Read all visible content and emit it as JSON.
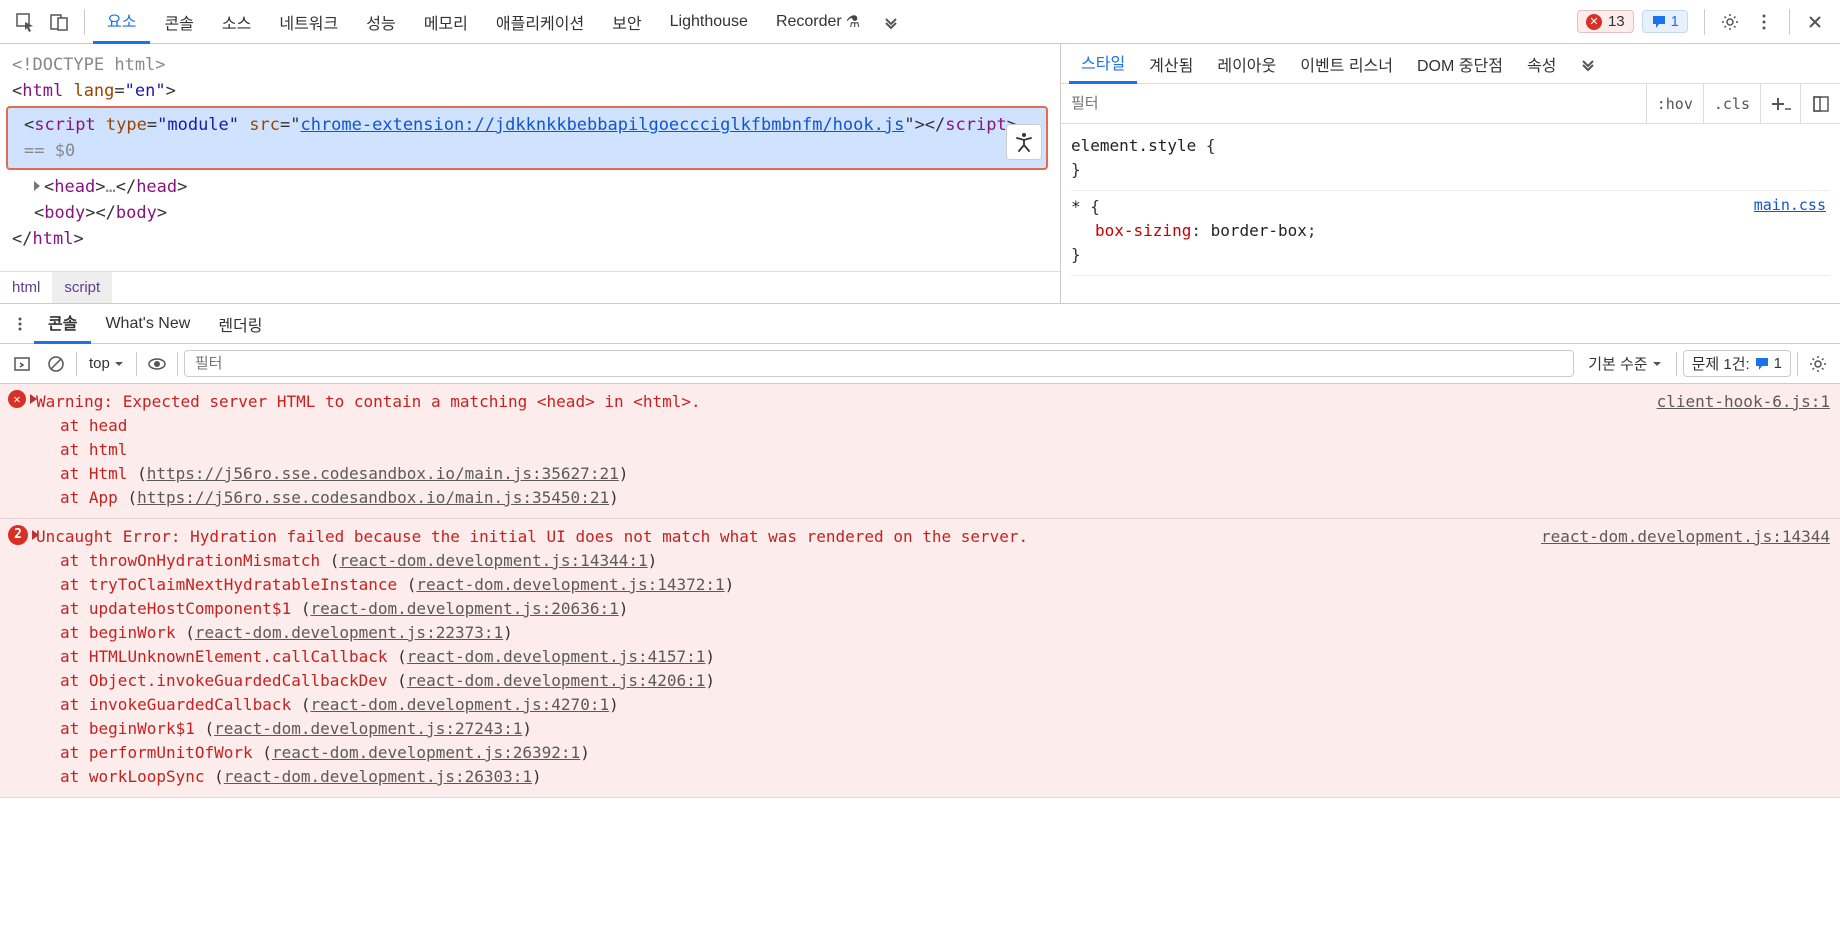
{
  "toolbar": {
    "tabs": [
      "요소",
      "콘솔",
      "소스",
      "네트워크",
      "성능",
      "메모리",
      "애플리케이션",
      "보안",
      "Lighthouse",
      "Recorder"
    ],
    "active_tab": 0,
    "error_count": "13",
    "message_count": "1"
  },
  "dom": {
    "doctype": "<!DOCTYPE html>",
    "html_open": "html",
    "html_lang_attr": "lang",
    "html_lang_val": "\"en\"",
    "script_tag": "script",
    "script_type_attr": "type",
    "script_type_val": "\"module\"",
    "script_src_attr": "src",
    "script_src_val": "chrome-extension://jdkknkkbebbapilgoeccciglkfbmbnfm/hook.js",
    "eq0": "== $0",
    "head": "head",
    "head_ellipsis": "…",
    "body": "body",
    "html_close": "html"
  },
  "breadcrumb": {
    "items": [
      "html",
      "script"
    ]
  },
  "styles_panel": {
    "tabs": [
      "스타일",
      "계산됨",
      "레이아웃",
      "이벤트 리스너",
      "DOM 중단점",
      "속성"
    ],
    "filter_placeholder": "필터",
    "hov": ":hov",
    "cls": ".cls",
    "rule1_selector": "element.style",
    "rule2_selector": "*",
    "rule2_src": "main.css",
    "rule2_prop": "box-sizing",
    "rule2_val": "border-box"
  },
  "drawer": {
    "tabs": [
      "콘솔",
      "What's New",
      "렌더링"
    ],
    "active": 0
  },
  "console_toolbar": {
    "context": "top",
    "filter_placeholder": "필터",
    "level_label": "기본 수준",
    "issues_label": "문제 1건:",
    "issues_count": "1"
  },
  "console": {
    "msg1": {
      "text": "Warning: Expected server HTML to contain a matching <head> in <html>.",
      "src": "client-hook-6.js:1",
      "stack": [
        {
          "at": "at ",
          "fn": "head",
          "loc": ""
        },
        {
          "at": "at ",
          "fn": "html",
          "loc": ""
        },
        {
          "at": "at ",
          "fn": "Html",
          "loc": "https://j56ro.sse.codesandbox.io/main.js:35627:21"
        },
        {
          "at": "at ",
          "fn": "App",
          "loc": "https://j56ro.sse.codesandbox.io/main.js:35450:21"
        }
      ]
    },
    "msg2": {
      "count": "2",
      "text": "Uncaught Error: Hydration failed because the initial UI does not match what was rendered on the server.",
      "src": "react-dom.development.js:14344",
      "stack": [
        {
          "at": "at ",
          "fn": "throwOnHydrationMismatch",
          "loc": "react-dom.development.js:14344:1"
        },
        {
          "at": "at ",
          "fn": "tryToClaimNextHydratableInstance",
          "loc": "react-dom.development.js:14372:1"
        },
        {
          "at": "at ",
          "fn": "updateHostComponent$1",
          "loc": "react-dom.development.js:20636:1"
        },
        {
          "at": "at ",
          "fn": "beginWork",
          "loc": "react-dom.development.js:22373:1"
        },
        {
          "at": "at ",
          "fn": "HTMLUnknownElement.callCallback",
          "loc": "react-dom.development.js:4157:1"
        },
        {
          "at": "at ",
          "fn": "Object.invokeGuardedCallbackDev",
          "loc": "react-dom.development.js:4206:1"
        },
        {
          "at": "at ",
          "fn": "invokeGuardedCallback",
          "loc": "react-dom.development.js:4270:1"
        },
        {
          "at": "at ",
          "fn": "beginWork$1",
          "loc": "react-dom.development.js:27243:1"
        },
        {
          "at": "at ",
          "fn": "performUnitOfWork",
          "loc": "react-dom.development.js:26392:1"
        },
        {
          "at": "at ",
          "fn": "workLoopSync",
          "loc": "react-dom.development.js:26303:1"
        }
      ]
    }
  }
}
